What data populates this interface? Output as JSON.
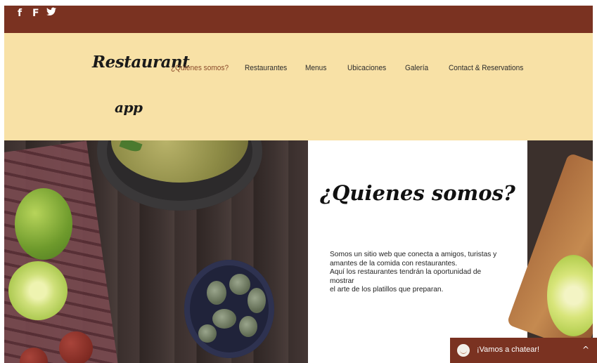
{
  "social": {
    "facebook_glyph": "f",
    "foursquare_glyph": "F",
    "twitter_glyph": "🐦"
  },
  "brand": {
    "line1": "Restaurant",
    "line2": "app"
  },
  "nav": [
    {
      "label": "¿Quienes somos?",
      "active": true
    },
    {
      "label": "Restaurantes",
      "active": false
    },
    {
      "label": "Menus",
      "active": false
    },
    {
      "label": "Ubicaciones",
      "active": false
    },
    {
      "label": "Galería",
      "active": false
    },
    {
      "label": "Contact & Reservations",
      "active": false
    }
  ],
  "about": {
    "title": "¿Quienes somos?",
    "text_line1": "Somos un sitio web que conecta a amigos, turistas y",
    "text_line2": "amantes de la comida con restaurantes.",
    "text_line3": "Aquí los restaurantes tendrán la oportunidad de  mostrar",
    "text_line4": "el arte de los platillos que preparan."
  },
  "chat": {
    "label": "¡Vamos a chatear!",
    "caret": "^"
  },
  "colors": {
    "topbar": "#7a3221",
    "header": "#f8e1a6",
    "accent": "#8a4a2a"
  }
}
